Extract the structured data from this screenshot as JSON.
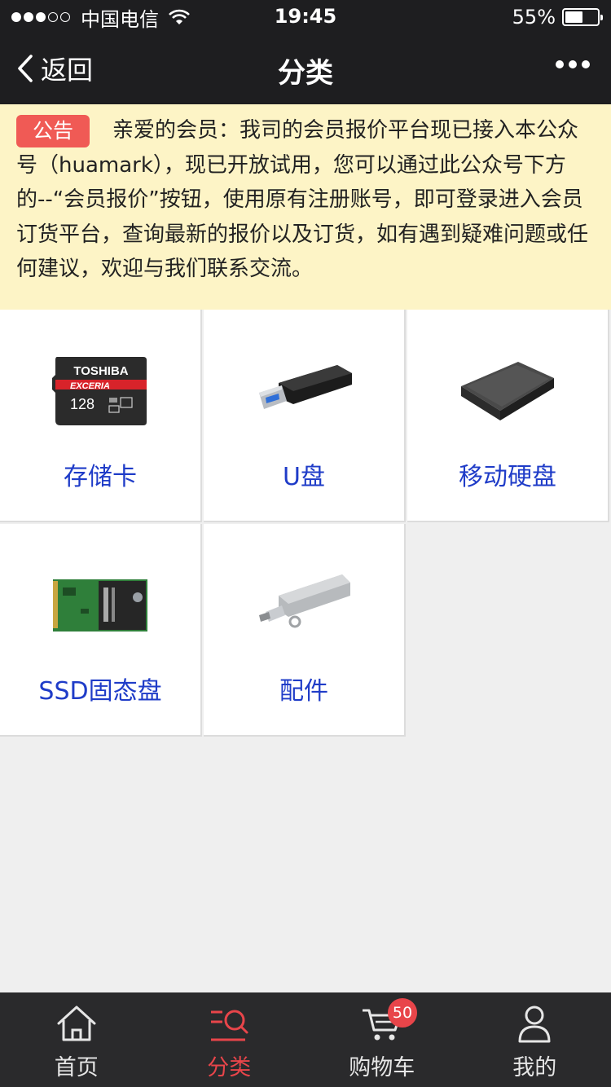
{
  "status_bar": {
    "carrier": "中国电信",
    "time": "19:45",
    "battery": "55%",
    "battery_level": 0.55,
    "signal_bars": 3
  },
  "nav": {
    "back_label": "返回",
    "title": "分类"
  },
  "notice": {
    "tag": "公告",
    "text": "亲爱的会员：我司的会员报价平台现已接入本公众号（huamark），现已开放试用，您可以通过此公众号下方的--“会员报价”按钮，使用原有注册账号，即可登录进入会员订货平台，查询最新的报价以及订货，如有遇到疑难问题或任何建议，欢迎与我们联系交流。"
  },
  "categories": [
    {
      "label": "存储卡",
      "icon": "sd-card-icon"
    },
    {
      "label": "U盘",
      "icon": "usb-drive-icon"
    },
    {
      "label": "移动硬盘",
      "icon": "external-hdd-icon"
    },
    {
      "label": "SSD固态盘",
      "icon": "ssd-icon"
    },
    {
      "label": "配件",
      "icon": "otg-adapter-icon"
    }
  ],
  "card_image": {
    "brand": "TOSHIBA",
    "series": "EXCERIA",
    "capacity": "128"
  },
  "tabbar": {
    "items": [
      {
        "label": "首页",
        "icon": "home-icon"
      },
      {
        "label": "分类",
        "icon": "category-icon",
        "active": true
      },
      {
        "label": "购物车",
        "icon": "cart-icon"
      },
      {
        "label": "我的",
        "icon": "user-icon"
      }
    ],
    "cart_badge": "50"
  },
  "colors": {
    "nav_bg": "#1e1e20",
    "notice_bg": "#fdf4c6",
    "tag_bg": "#f05a55",
    "link": "#1f3cc8",
    "active_tab": "#e8454a"
  }
}
